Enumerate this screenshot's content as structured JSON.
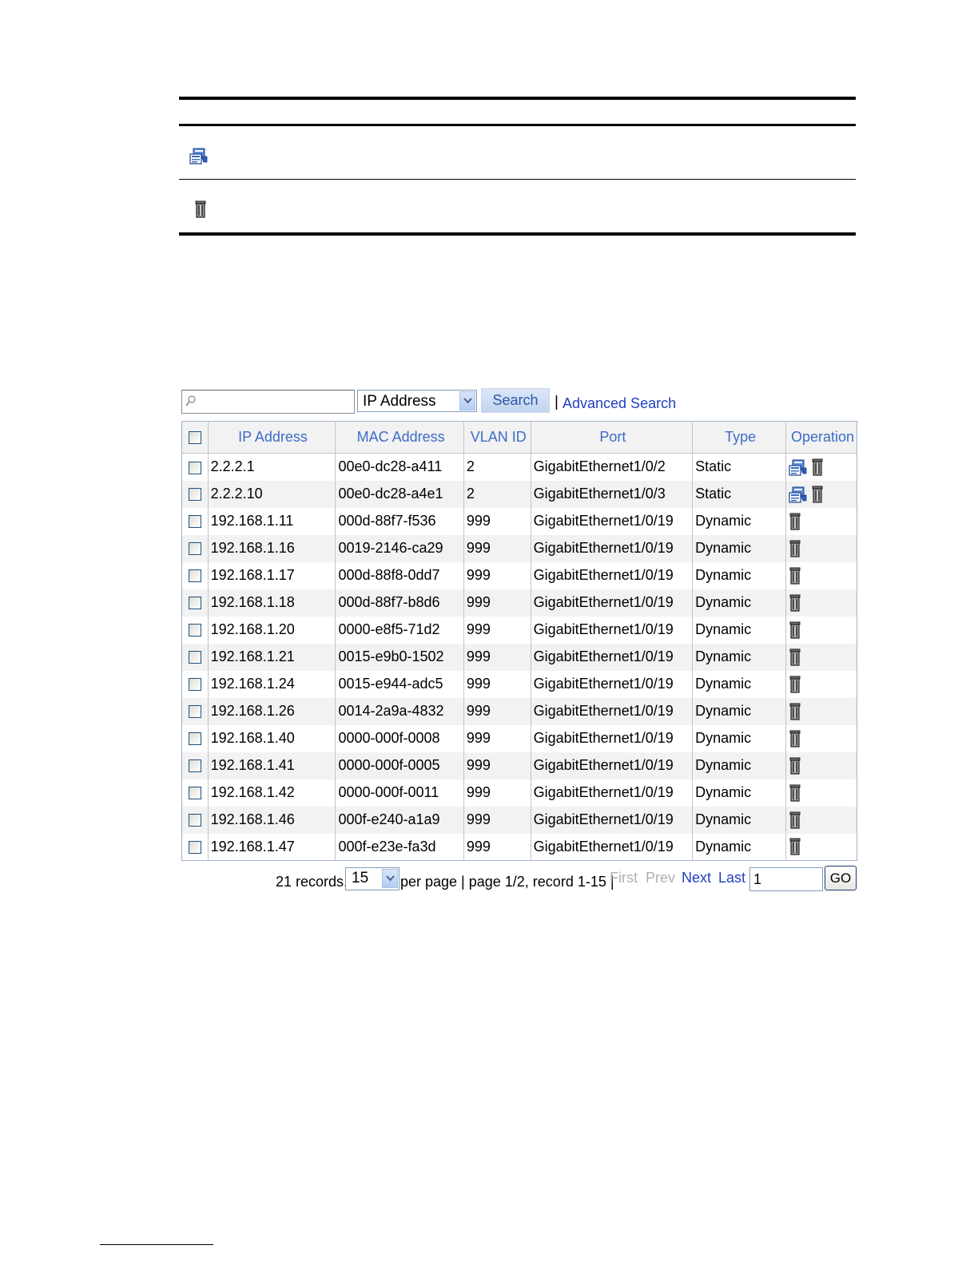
{
  "legend": {
    "rows": [
      {
        "icon": "edit-icon"
      },
      {
        "icon": "delete-icon"
      }
    ]
  },
  "search": {
    "value": "",
    "placeholder": "",
    "field_selected": "IP Address",
    "button_label": "Search",
    "separator": "|",
    "advanced_label": "Advanced Search"
  },
  "table": {
    "headers": {
      "ip": "IP Address",
      "mac": "MAC Address",
      "vlan": "VLAN ID",
      "port": "Port",
      "type": "Type",
      "operation": "Operation"
    },
    "rows": [
      {
        "ip": "2.2.2.1",
        "mac": "00e0-dc28-a411",
        "vlan": "2",
        "port": "GigabitEthernet1/0/2",
        "type": "Static",
        "ops": [
          "edit-icon",
          "delete-icon"
        ]
      },
      {
        "ip": "2.2.2.10",
        "mac": "00e0-dc28-a4e1",
        "vlan": "2",
        "port": "GigabitEthernet1/0/3",
        "type": "Static",
        "ops": [
          "edit-icon",
          "delete-icon"
        ]
      },
      {
        "ip": "192.168.1.11",
        "mac": "000d-88f7-f536",
        "vlan": "999",
        "port": "GigabitEthernet1/0/19",
        "type": "Dynamic",
        "ops": [
          "delete-icon"
        ]
      },
      {
        "ip": "192.168.1.16",
        "mac": "0019-2146-ca29",
        "vlan": "999",
        "port": "GigabitEthernet1/0/19",
        "type": "Dynamic",
        "ops": [
          "delete-icon"
        ]
      },
      {
        "ip": "192.168.1.17",
        "mac": "000d-88f8-0dd7",
        "vlan": "999",
        "port": "GigabitEthernet1/0/19",
        "type": "Dynamic",
        "ops": [
          "delete-icon"
        ]
      },
      {
        "ip": "192.168.1.18",
        "mac": "000d-88f7-b8d6",
        "vlan": "999",
        "port": "GigabitEthernet1/0/19",
        "type": "Dynamic",
        "ops": [
          "delete-icon"
        ]
      },
      {
        "ip": "192.168.1.20",
        "mac": "0000-e8f5-71d2",
        "vlan": "999",
        "port": "GigabitEthernet1/0/19",
        "type": "Dynamic",
        "ops": [
          "delete-icon"
        ]
      },
      {
        "ip": "192.168.1.21",
        "mac": "0015-e9b0-1502",
        "vlan": "999",
        "port": "GigabitEthernet1/0/19",
        "type": "Dynamic",
        "ops": [
          "delete-icon"
        ]
      },
      {
        "ip": "192.168.1.24",
        "mac": "0015-e944-adc5",
        "vlan": "999",
        "port": "GigabitEthernet1/0/19",
        "type": "Dynamic",
        "ops": [
          "delete-icon"
        ]
      },
      {
        "ip": "192.168.1.26",
        "mac": "0014-2a9a-4832",
        "vlan": "999",
        "port": "GigabitEthernet1/0/19",
        "type": "Dynamic",
        "ops": [
          "delete-icon"
        ]
      },
      {
        "ip": "192.168.1.40",
        "mac": "0000-000f-0008",
        "vlan": "999",
        "port": "GigabitEthernet1/0/19",
        "type": "Dynamic",
        "ops": [
          "delete-icon"
        ]
      },
      {
        "ip": "192.168.1.41",
        "mac": "0000-000f-0005",
        "vlan": "999",
        "port": "GigabitEthernet1/0/19",
        "type": "Dynamic",
        "ops": [
          "delete-icon"
        ]
      },
      {
        "ip": "192.168.1.42",
        "mac": "0000-000f-0011",
        "vlan": "999",
        "port": "GigabitEthernet1/0/19",
        "type": "Dynamic",
        "ops": [
          "delete-icon"
        ]
      },
      {
        "ip": "192.168.1.46",
        "mac": "000f-e240-a1a9",
        "vlan": "999",
        "port": "GigabitEthernet1/0/19",
        "type": "Dynamic",
        "ops": [
          "delete-icon"
        ]
      },
      {
        "ip": "192.168.1.47",
        "mac": "000f-e23e-fa3d",
        "vlan": "999",
        "port": "GigabitEthernet1/0/19",
        "type": "Dynamic",
        "ops": [
          "delete-icon"
        ]
      }
    ]
  },
  "pager": {
    "records_text": "21 records,",
    "per_page_value": "15",
    "per_page_text": "per page | page 1/2, record 1-15 |",
    "first": "First",
    "prev": "Prev",
    "next": "Next",
    "last": "Last",
    "page_input": "1",
    "go": "GO"
  },
  "colors": {
    "link": "#1f3fbf",
    "header_text": "#3b6cc8",
    "row_alt": "#f2f2f2",
    "border": "#9fb3cf"
  }
}
